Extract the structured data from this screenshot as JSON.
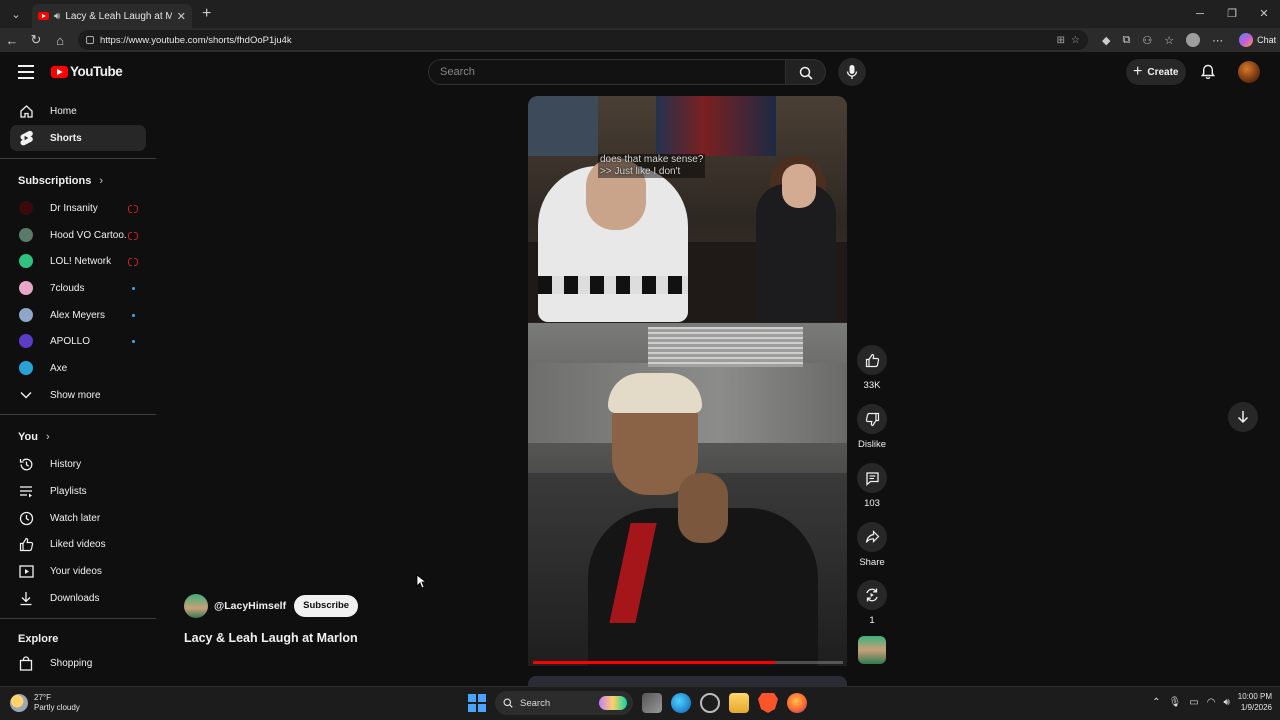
{
  "browser": {
    "tab_title": "Lacy & Leah Laugh at Marlon",
    "url": "https://www.youtube.com/shorts/fhdOoP1ju4k",
    "chat_label": "Chat"
  },
  "header": {
    "logo_text": "YouTube",
    "search_placeholder": "Search",
    "create_label": "Create"
  },
  "sidebar": {
    "main": [
      {
        "label": "Home"
      },
      {
        "label": "Shorts"
      }
    ],
    "subscriptions_heading": "Subscriptions",
    "subscriptions": [
      {
        "label": "Dr Insanity",
        "status": "live",
        "color": "#3a0a0a"
      },
      {
        "label": "Hood VO Cartoo...",
        "status": "live",
        "color": "#5a7a6a"
      },
      {
        "label": "LOL! Network",
        "status": "live",
        "color": "#2ec27e"
      },
      {
        "label": "7clouds",
        "status": "new",
        "color": "#e8a6c8"
      },
      {
        "label": "Alex Meyers",
        "status": "new",
        "color": "#8ea6c8"
      },
      {
        "label": "APOLLO",
        "status": "new",
        "color": "#5a3cc8"
      },
      {
        "label": "Axe",
        "status": "none",
        "color": "#29a3d6"
      }
    ],
    "show_more": "Show more",
    "you_heading": "You",
    "you_items": [
      {
        "label": "History"
      },
      {
        "label": "Playlists"
      },
      {
        "label": "Watch later"
      },
      {
        "label": "Liked videos"
      },
      {
        "label": "Your videos"
      },
      {
        "label": "Downloads"
      }
    ],
    "explore_heading": "Explore",
    "explore_items": [
      {
        "label": "Shopping"
      }
    ]
  },
  "short": {
    "caption_line1": "does that make sense?",
    "caption_line2": ">> Just like I don't",
    "channel": "@LacyHimself",
    "subscribe_label": "Subscribe",
    "title": "Lacy & Leah Laugh at Marlon",
    "progress": 0.78
  },
  "actions": {
    "likes": "33K",
    "dislike": "Dislike",
    "comments": "103",
    "share": "Share",
    "remix": "1"
  },
  "taskbar": {
    "temp": "27°F",
    "weather": "Partly cloudy",
    "search_label": "Search",
    "time": "10:00 PM",
    "date": "1/9/2026"
  }
}
